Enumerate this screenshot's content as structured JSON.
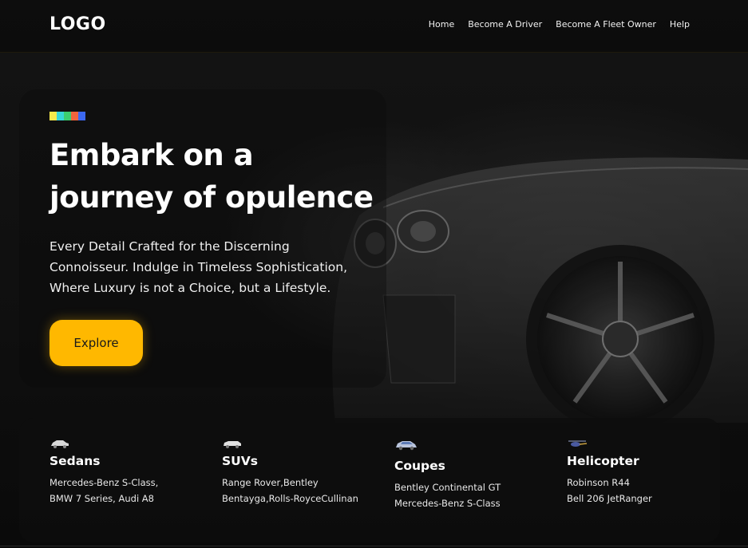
{
  "nav": {
    "logo": "LOGO",
    "links": [
      "Home",
      "Become A Driver",
      "Become A Fleet Owner",
      "Help"
    ]
  },
  "hero": {
    "accent_colors": [
      "#f5e94b",
      "#37d6d6",
      "#3ccf6e",
      "#f0643c",
      "#3c68f0"
    ],
    "title": "Embark on a journey of opulence",
    "description": "Every Detail Crafted for the Discerning Connoisseur. Indulge in Timeless Sophistication, Where Luxury is not a Choice, but a Lifestyle.",
    "cta_label": "Explore"
  },
  "categories": [
    {
      "icon": "sedan-car-icon",
      "title": "Sedans",
      "lines": [
        "Mercedes-Benz S-Class,",
        "BMW 7 Series, Audi A8"
      ]
    },
    {
      "icon": "suv-car-icon",
      "title": "SUVs",
      "lines": [
        "Range Rover,Bentley",
        "Bentayga,Rolls-RoyceCullinan"
      ]
    },
    {
      "icon": "coupe-car-icon",
      "title": "Coupes",
      "lines": [
        "Bentley Continental GT",
        "Mercedes-Benz S-Class"
      ]
    },
    {
      "icon": "helicopter-icon",
      "title": "Helicopter",
      "lines": [
        "Robinson R44",
        "Bell 206 JetRanger"
      ]
    }
  ],
  "colors": {
    "accent": "#ffb800",
    "background": "#0c0c0c",
    "text": "#ffffff"
  }
}
